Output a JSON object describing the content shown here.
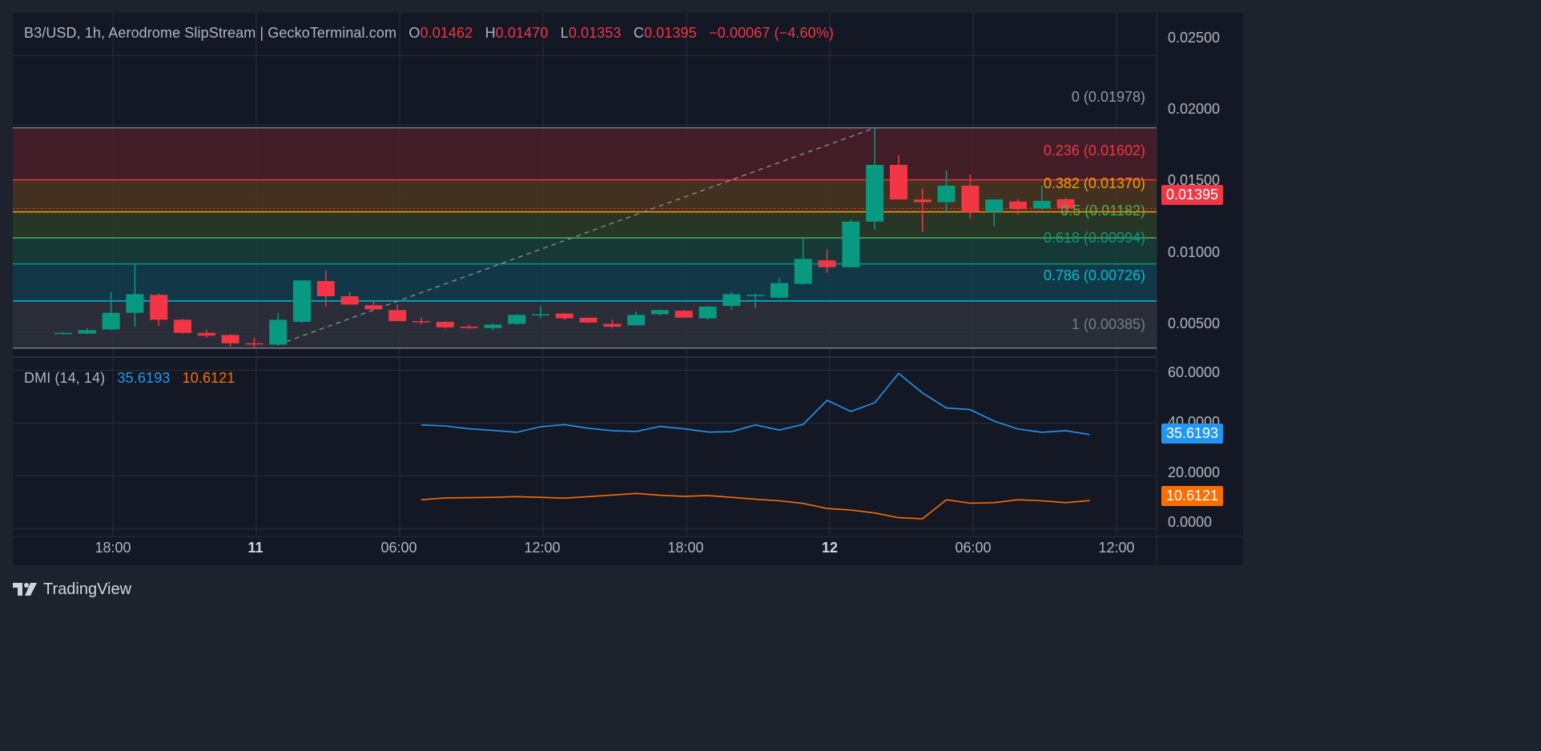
{
  "header": {
    "symbol": "B3/USD, 1h, Aerodrome SlipStream | GeckoTerminal.com",
    "o_label": "O",
    "o_value": "0.01462",
    "h_label": "H",
    "h_value": "0.01470",
    "l_label": "L",
    "l_value": "0.01353",
    "c_label": "C",
    "c_value": "0.01395",
    "change": "−0.00067 (−4.60%)"
  },
  "price_axis": {
    "ticks": [
      "0.02500",
      "0.02000",
      "0.01500",
      "0.01000",
      "0.00500"
    ],
    "last_price": "0.01395"
  },
  "dmi": {
    "title": "DMI (14, 14)",
    "plus_di": "35.6193",
    "minus_di": "10.6121",
    "ticks": [
      "60.0000",
      "40.0000",
      "20.0000",
      "0.0000"
    ],
    "plus_tag": "35.6193",
    "minus_tag": "10.6121"
  },
  "time_axis": {
    "labels": [
      "18:00",
      "11",
      "06:00",
      "12:00",
      "18:00",
      "12",
      "06:00",
      "12:00"
    ]
  },
  "fib_labels": [
    "0 (0.01978)",
    "0.236 (0.01602)",
    "0.382 (0.01370)",
    "0.5 (0.01182)",
    "0.618 (0.00994)",
    "0.786 (0.00726)",
    "1 (0.00385)"
  ],
  "brand": {
    "name": "TradingView"
  },
  "colors": {
    "up": "#089981",
    "down": "#f23645",
    "plus_di": "#2196f3",
    "minus_di": "#ff6d00",
    "background": "#141824",
    "chrome": "#1e222d"
  },
  "chart_data": {
    "type": "candlestick",
    "pair": "B3/USD",
    "interval": "1h",
    "price_range": [
      0.0032,
      0.0281
    ],
    "candles": [
      {
        "o": 0.0049,
        "h": 0.005,
        "l": 0.00485,
        "c": 0.00495
      },
      {
        "o": 0.0049,
        "h": 0.0053,
        "l": 0.00485,
        "c": 0.00515
      },
      {
        "o": 0.0052,
        "h": 0.0079,
        "l": 0.00515,
        "c": 0.0064
      },
      {
        "o": 0.0064,
        "h": 0.0099,
        "l": 0.0054,
        "c": 0.00775
      },
      {
        "o": 0.0077,
        "h": 0.0078,
        "l": 0.00545,
        "c": 0.0059
      },
      {
        "o": 0.0059,
        "h": 0.00595,
        "l": 0.0049,
        "c": 0.00495
      },
      {
        "o": 0.00495,
        "h": 0.0052,
        "l": 0.0046,
        "c": 0.00475
      },
      {
        "o": 0.0048,
        "h": 0.00485,
        "l": 0.00395,
        "c": 0.0042
      },
      {
        "o": 0.0042,
        "h": 0.0046,
        "l": 0.0038,
        "c": 0.00415
      },
      {
        "o": 0.0041,
        "h": 0.0064,
        "l": 0.00405,
        "c": 0.0059
      },
      {
        "o": 0.00575,
        "h": 0.00875,
        "l": 0.00565,
        "c": 0.00875
      },
      {
        "o": 0.0087,
        "h": 0.00945,
        "l": 0.00685,
        "c": 0.0076
      },
      {
        "o": 0.0076,
        "h": 0.0079,
        "l": 0.007,
        "c": 0.007
      },
      {
        "o": 0.00695,
        "h": 0.00725,
        "l": 0.00665,
        "c": 0.00665
      },
      {
        "o": 0.0066,
        "h": 0.007,
        "l": 0.0058,
        "c": 0.0058
      },
      {
        "o": 0.0058,
        "h": 0.00605,
        "l": 0.00555,
        "c": 0.00575
      },
      {
        "o": 0.00575,
        "h": 0.0058,
        "l": 0.00525,
        "c": 0.00535
      },
      {
        "o": 0.0054,
        "h": 0.00555,
        "l": 0.00525,
        "c": 0.0053
      },
      {
        "o": 0.0053,
        "h": 0.00565,
        "l": 0.00515,
        "c": 0.00555
      },
      {
        "o": 0.0056,
        "h": 0.0063,
        "l": 0.00555,
        "c": 0.00625
      },
      {
        "o": 0.00625,
        "h": 0.0069,
        "l": 0.006,
        "c": 0.0063
      },
      {
        "o": 0.00635,
        "h": 0.0064,
        "l": 0.0059,
        "c": 0.006
      },
      {
        "o": 0.00605,
        "h": 0.00605,
        "l": 0.00565,
        "c": 0.0057
      },
      {
        "o": 0.0056,
        "h": 0.0059,
        "l": 0.0053,
        "c": 0.0054
      },
      {
        "o": 0.0055,
        "h": 0.0065,
        "l": 0.0055,
        "c": 0.00625
      },
      {
        "o": 0.0063,
        "h": 0.00665,
        "l": 0.0062,
        "c": 0.0066
      },
      {
        "o": 0.00655,
        "h": 0.0066,
        "l": 0.00605,
        "c": 0.00605
      },
      {
        "o": 0.006,
        "h": 0.0069,
        "l": 0.0059,
        "c": 0.00685
      },
      {
        "o": 0.0069,
        "h": 0.0079,
        "l": 0.00665,
        "c": 0.00775
      },
      {
        "o": 0.0077,
        "h": 0.0078,
        "l": 0.00675,
        "c": 0.0077
      },
      {
        "o": 0.0075,
        "h": 0.0089,
        "l": 0.00745,
        "c": 0.00855
      },
      {
        "o": 0.0085,
        "h": 0.0118,
        "l": 0.00845,
        "c": 0.0103
      },
      {
        "o": 0.0102,
        "h": 0.011,
        "l": 0.0093,
        "c": 0.0097
      },
      {
        "o": 0.0097,
        "h": 0.01315,
        "l": 0.0097,
        "c": 0.013
      },
      {
        "o": 0.013,
        "h": 0.01978,
        "l": 0.0124,
        "c": 0.0171
      },
      {
        "o": 0.0171,
        "h": 0.0178,
        "l": 0.0146,
        "c": 0.0146
      },
      {
        "o": 0.0146,
        "h": 0.0154,
        "l": 0.01225,
        "c": 0.0144
      },
      {
        "o": 0.0144,
        "h": 0.0167,
        "l": 0.0136,
        "c": 0.0156
      },
      {
        "o": 0.0156,
        "h": 0.0164,
        "l": 0.0132,
        "c": 0.0137
      },
      {
        "o": 0.0137,
        "h": 0.0146,
        "l": 0.01265,
        "c": 0.0146
      },
      {
        "o": 0.01445,
        "h": 0.0146,
        "l": 0.0135,
        "c": 0.0139
      },
      {
        "o": 0.01395,
        "h": 0.0156,
        "l": 0.01385,
        "c": 0.0145
      },
      {
        "o": 0.01462,
        "h": 0.0147,
        "l": 0.01353,
        "c": 0.01395
      }
    ],
    "fibonacci": {
      "levels": [
        {
          "ratio": "0",
          "price": 0.01978,
          "color": "#787b86",
          "fill": "#4a1f28"
        },
        {
          "ratio": "0.236",
          "price": 0.01602,
          "color": "#f23645",
          "fill": "#4a3520"
        },
        {
          "ratio": "0.382",
          "price": 0.0137,
          "color": "#ff9800",
          "fill": "#2a3c28"
        },
        {
          "ratio": "0.5",
          "price": 0.01182,
          "color": "#4caf50",
          "fill": "#163e39"
        },
        {
          "ratio": "0.618",
          "price": 0.00994,
          "color": "#089981",
          "fill": "#123e4e"
        },
        {
          "ratio": "0.786",
          "price": 0.00726,
          "color": "#00bcd4",
          "fill": "#2e313c"
        },
        {
          "ratio": "1",
          "price": 0.00385,
          "color": "#787b86",
          "fill": null
        }
      ],
      "trend_line": {
        "from_index": 9,
        "from_price": 0.0041,
        "to_index": 34,
        "to_price": 0.01978
      }
    },
    "dmi_period": [
      14,
      14
    ],
    "dmi_range": [
      -3,
      65
    ],
    "dmi_start_index": 15,
    "plus_di": [
      39.3,
      38.9,
      37.8,
      37.2,
      36.5,
      38.6,
      39.4,
      38.0,
      37.1,
      36.8,
      38.7,
      37.8,
      36.6,
      36.7,
      39.3,
      37.3,
      39.5,
      48.6,
      44.4,
      47.7,
      58.8,
      51.4,
      45.7,
      45.1,
      40.7,
      37.7,
      36.5,
      37.1,
      35.6
    ],
    "minus_di": [
      10.9,
      11.6,
      11.7,
      11.8,
      12.1,
      11.8,
      11.5,
      12.1,
      12.7,
      13.3,
      12.6,
      12.2,
      12.5,
      11.8,
      11.1,
      10.5,
      9.5,
      7.6,
      7.0,
      5.9,
      4.1,
      3.7,
      10.9,
      9.6,
      9.8,
      10.9,
      10.5,
      9.8,
      10.6
    ],
    "time_labels": [
      "18:00",
      "11",
      "06:00",
      "12:00",
      "18:00",
      "12",
      "06:00",
      "12:00"
    ]
  }
}
